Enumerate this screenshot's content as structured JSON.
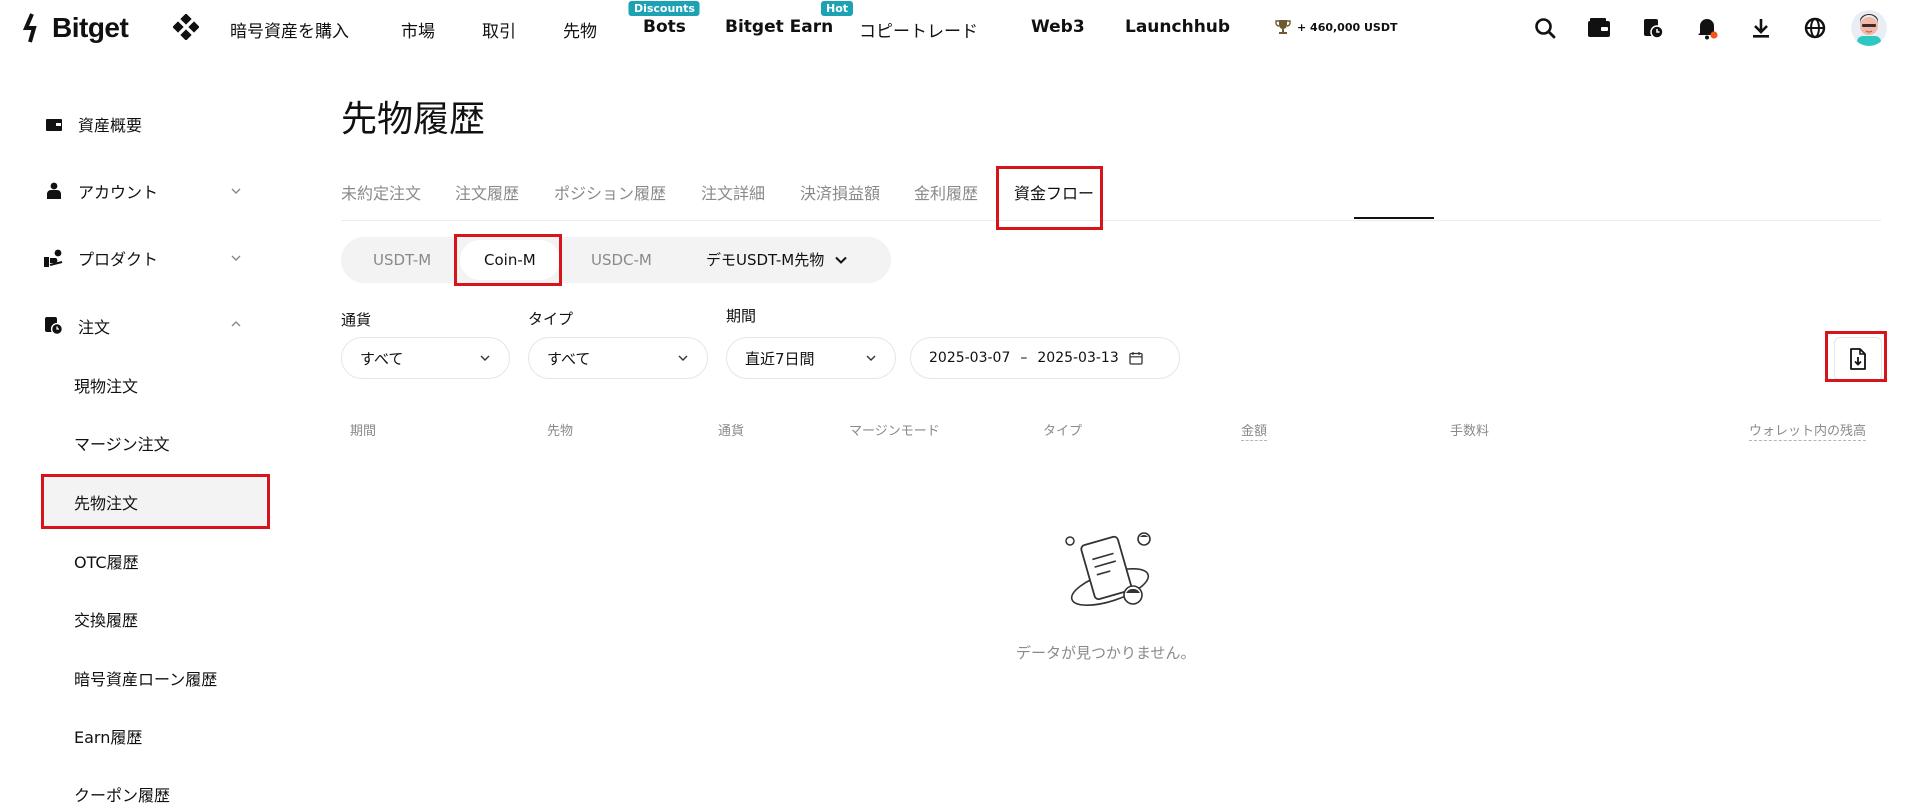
{
  "header": {
    "logo_text": "Bitget",
    "nav": [
      {
        "label": "暗号資産を購入",
        "badge": ""
      },
      {
        "label": "市場",
        "badge": ""
      },
      {
        "label": "取引",
        "badge": ""
      },
      {
        "label": "先物",
        "badge": ""
      },
      {
        "label": "Bots",
        "badge": "Discounts"
      },
      {
        "label": "Bitget Earn",
        "badge": "Hot"
      },
      {
        "label": "コピートレード",
        "badge": ""
      },
      {
        "label": "Web3",
        "badge": ""
      },
      {
        "label": "Launchhub",
        "badge": ""
      }
    ],
    "promo_text": "+ 460,000 USDT",
    "icons": [
      "search-icon",
      "wallet-icon",
      "orders-icon",
      "bell-icon",
      "download-icon",
      "globe-icon"
    ],
    "notification_dot_color": "#f0561a",
    "badge_color": "#1da2b4"
  },
  "sidebar": {
    "top_items": [
      {
        "label": "資産概要",
        "icon": "wallet-icon",
        "expandable": false
      },
      {
        "label": "アカウント",
        "icon": "user-icon",
        "expandable": true,
        "expanded": false
      },
      {
        "label": "プロダクト",
        "icon": "product-icon",
        "expandable": true,
        "expanded": false
      },
      {
        "label": "注文",
        "icon": "orders-icon",
        "expandable": true,
        "expanded": true
      }
    ],
    "sub_items": [
      {
        "label": "現物注文"
      },
      {
        "label": "マージン注文"
      },
      {
        "label": "先物注文",
        "active": true
      },
      {
        "label": "OTC履歴"
      },
      {
        "label": "交換履歴"
      },
      {
        "label": "暗号資産ローン履歴"
      },
      {
        "label": "Earn履歴"
      },
      {
        "label": "クーポン履歴"
      }
    ]
  },
  "main": {
    "title": "先物履歴",
    "tabs": [
      {
        "label": "未約定注文"
      },
      {
        "label": "注文履歴"
      },
      {
        "label": "ポジション履歴"
      },
      {
        "label": "注文詳細"
      },
      {
        "label": "決済損益額"
      },
      {
        "label": "金利履歴"
      },
      {
        "label": "資金フロー",
        "active": true
      }
    ],
    "segments": [
      {
        "label": "USDT-M"
      },
      {
        "label": "Coin-M",
        "active": true
      },
      {
        "label": "USDC-M"
      },
      {
        "label": "デモUSDT-M先物"
      }
    ],
    "filters": {
      "currency_label": "通貨",
      "currency_value": "すべて",
      "type_label": "タイプ",
      "type_value": "すべて",
      "period_label": "期間",
      "period_value": "直近7日間",
      "date_start": "2025-03-07",
      "date_sep": "–",
      "date_end": "2025-03-13"
    },
    "table_headers": [
      "期間",
      "先物",
      "通貨",
      "マージンモード",
      "タイプ",
      "金額",
      "手数料",
      "ウォレット内の残高"
    ],
    "empty_text": "データが見つかりません。"
  },
  "highlight_color": "#d8141b"
}
